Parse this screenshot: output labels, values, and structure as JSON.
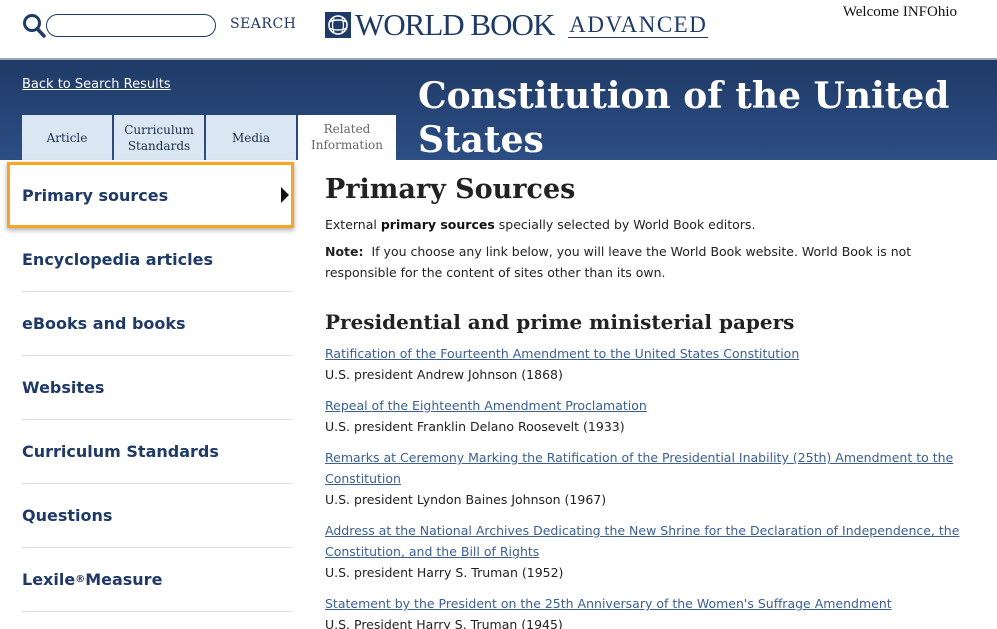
{
  "search": {
    "placeholder": "",
    "label": "SEARCH"
  },
  "brand": {
    "name": "WORLD BOOK",
    "edition": "ADVANCED"
  },
  "user": {
    "welcome": "Welcome INFOhio"
  },
  "header": {
    "back_link": "Back to Search Results",
    "title": "Constitution of the United States",
    "tabs": [
      {
        "label": "Article"
      },
      {
        "label": "Curriculum Standards"
      },
      {
        "label": "Media"
      },
      {
        "label": "Related Information"
      }
    ]
  },
  "sidebar": {
    "items": [
      {
        "label": "Primary sources",
        "active": true
      },
      {
        "label": "Encyclopedia articles"
      },
      {
        "label": "eBooks and books"
      },
      {
        "label": "Websites"
      },
      {
        "label": "Curriculum Standards"
      },
      {
        "label": "Questions"
      },
      {
        "label": "Lexile",
        "sup": "®",
        "suffix": " Measure"
      }
    ]
  },
  "main": {
    "heading": "Primary Sources",
    "intro_prefix": "External ",
    "intro_bold": "primary sources",
    "intro_suffix": " specially selected by World Book editors.",
    "note_label": "Note:",
    "note_text": "If you choose any link below, you will leave the World Book website. World Book is not responsible for the content of sites other than its own.",
    "section_heading": "Presidential and prime ministerial papers",
    "entries": [
      {
        "link": "Ratification of the Fourteenth Amendment to the United States Constitution",
        "desc": "U.S. president Andrew Johnson (1868)"
      },
      {
        "link": "Repeal of the Eighteenth Amendment Proclamation",
        "desc": "U.S. president Franklin Delano Roosevelt (1933)"
      },
      {
        "link": "Remarks at Ceremony Marking the Ratification of the Presidential Inability (25th) Amendment to the Constitution",
        "desc": "U.S. president Lyndon Baines Johnson (1967)"
      },
      {
        "link": "Address at the National Archives Dedicating the New Shrine for the Declaration of Independence, the Constitution, and the Bill of Rights",
        "desc": "U.S. president Harry S. Truman (1952)"
      },
      {
        "link": "Statement by the President on the 25th Anniversary of the Women's Suffrage Amendment",
        "desc": "U.S. President Harry S. Truman (1945)"
      }
    ]
  },
  "colors": {
    "navy": "#1f3a66",
    "highlight": "#f5a623",
    "link": "#3b5f94",
    "tab": "#dbe6f3"
  },
  "icons": {
    "search": "search-icon",
    "logo": "globe-logo-icon",
    "active_marker": "triangle-right-icon"
  }
}
